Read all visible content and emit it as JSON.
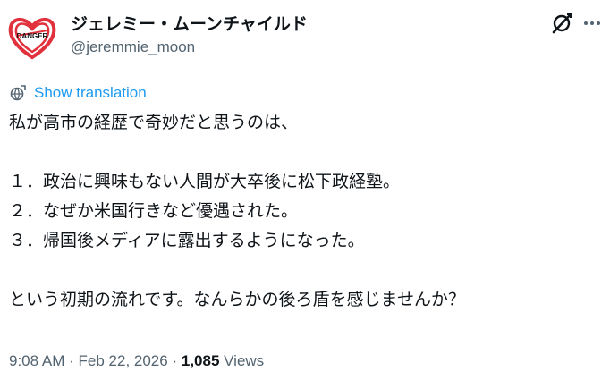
{
  "author": {
    "display_name": "ジェレミー・ムーンチャイルド",
    "handle": "@jeremmie_moon",
    "avatar_text": "DANGER"
  },
  "icons": {
    "avatar": "heart-danger-avatar",
    "grok": "grok-icon",
    "more": "more-horizontal-icon",
    "translate": "globe-icon"
  },
  "colors": {
    "accent": "#1d9bf0",
    "secondary_text": "#536471",
    "avatar_heart": "#e0313c"
  },
  "tweet": {
    "translate_label": "Show translation",
    "lines": [
      "私が高市の経歴で奇妙だと思うのは、",
      "",
      "１．政治に興味もない人間が大卒後に松下政経塾。",
      "２．なぜか米国行きなど優遇された。",
      "３．帰国後メディアに露出するようになった。",
      "",
      "という初期の流れです。なんらかの後ろ盾を感じませんか？"
    ]
  },
  "meta": {
    "time": "9:08 AM",
    "separator": "·",
    "date": "Feb 22, 2026",
    "views_count": "1,085",
    "views_label": "Views"
  }
}
